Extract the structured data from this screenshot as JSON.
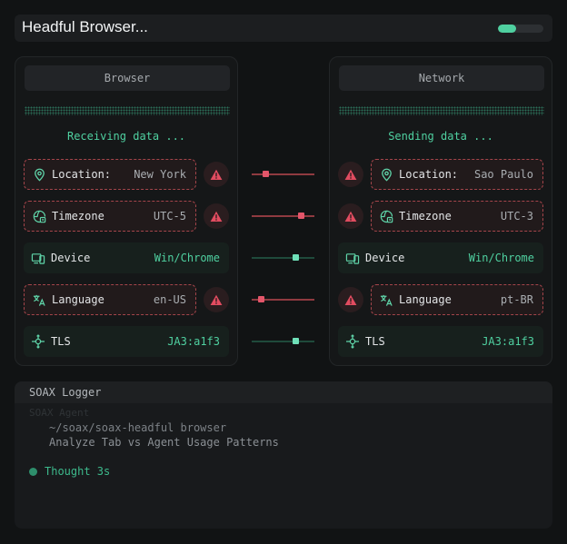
{
  "header": {
    "title": "Headful Browser...",
    "progress": 0.4
  },
  "browser": {
    "title": "Browser",
    "status": "Receiving data ...",
    "rows": [
      {
        "label": "Location:",
        "value": "New York",
        "state": "warn"
      },
      {
        "label": "Timezone",
        "value": "UTC-5",
        "state": "warn"
      },
      {
        "label": "Device",
        "value": "Win/Chrome",
        "state": "ok"
      },
      {
        "label": "Language",
        "value": "en-US",
        "state": "warn"
      },
      {
        "label": "TLS",
        "value": "JA3:a1f3",
        "state": "ok"
      }
    ]
  },
  "network": {
    "title": "Network",
    "status": "Sending data ...",
    "rows": [
      {
        "label": "Location:",
        "value": "Sao Paulo",
        "state": "warn"
      },
      {
        "label": "Timezone",
        "value": "UTC-3",
        "state": "warn"
      },
      {
        "label": "Device",
        "value": "Win/Chrome",
        "state": "ok"
      },
      {
        "label": "Language",
        "value": "pt-BR",
        "state": "warn"
      },
      {
        "label": "TLS",
        "value": "JA3:a1f3",
        "state": "ok"
      }
    ]
  },
  "links": [
    {
      "state": "mismatch",
      "position": 0.2
    },
    {
      "state": "mismatch",
      "position": 0.82
    },
    {
      "state": "match",
      "position": 0.72
    },
    {
      "state": "mismatch",
      "position": 0.12
    },
    {
      "state": "match",
      "position": 0.72
    }
  ],
  "logger": {
    "title": "SOAX Logger",
    "faded_line": "SOAX Agent",
    "path": "~/soax/soax-headful browser",
    "task": "Analyze Tab vs Agent Usage Patterns",
    "thought": "Thought 3s"
  },
  "colors": {
    "accent": "#4fd0a0",
    "warning": "#e3566a",
    "background": "#111314"
  },
  "icons": [
    "location-pin-icon",
    "timezone-globe-icon",
    "device-icon",
    "translate-icon",
    "network-node-icon",
    "warning-triangle-icon"
  ]
}
